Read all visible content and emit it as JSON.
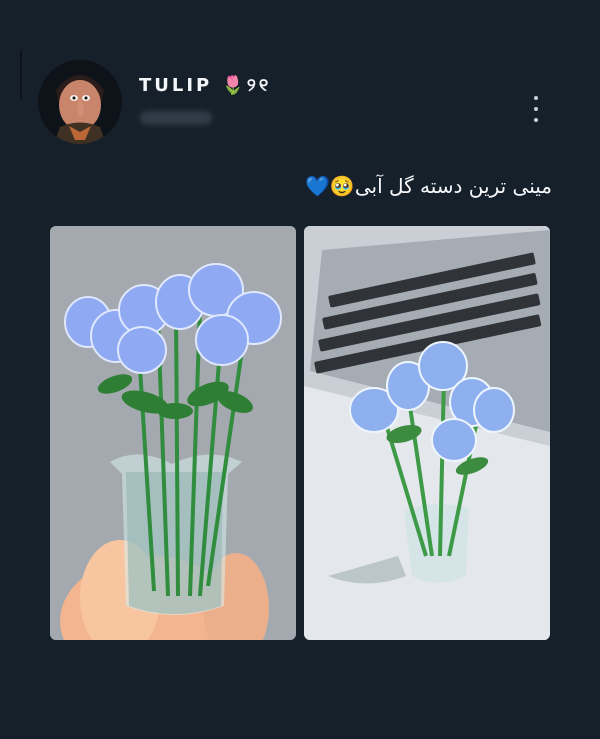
{
  "post": {
    "author_name": "TULIP 🌷୨୧",
    "text": "مینی ترین دسته گل آبی🥹💙",
    "more_icon": "more-vertical-icon",
    "images": [
      {
        "name": "glass-tulip-bouquet-in-hand"
      },
      {
        "name": "glass-tulip-bouquet-near-laptop"
      }
    ]
  }
}
